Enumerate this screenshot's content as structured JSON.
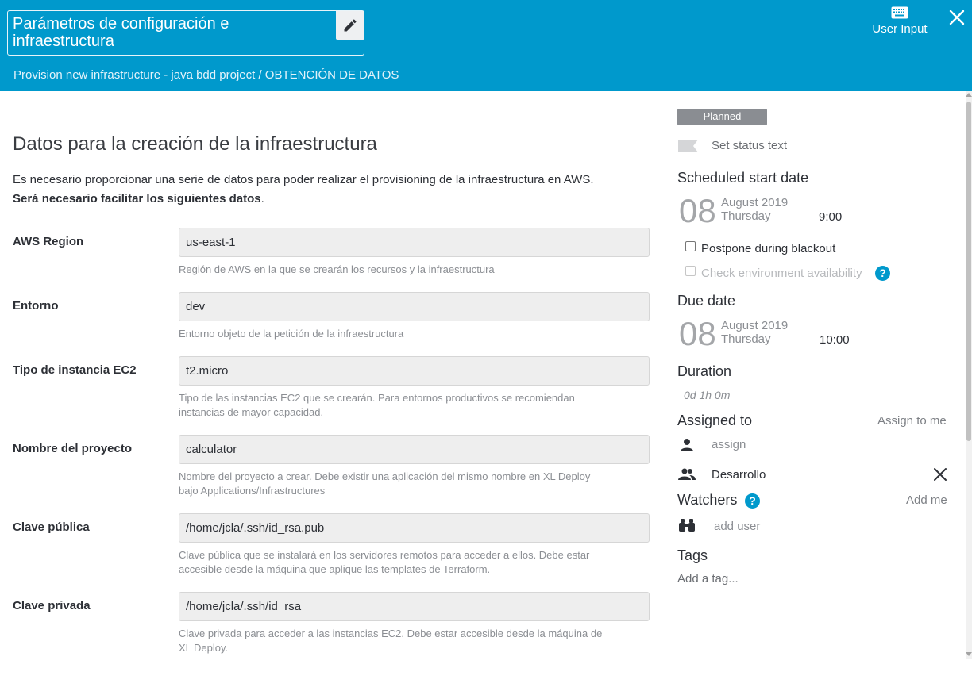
{
  "header": {
    "title": "Parámetros de configuración e infraestructura",
    "breadcrumb": "Provision new infrastructure - java bdd project / OBTENCIÓN DE DATOS",
    "user_input_label": "User Input",
    "edit_icon": "pencil-icon",
    "close_icon": "close-icon",
    "user_input_icon": "keyboard-icon",
    "bg_color": "#0099cc"
  },
  "main": {
    "heading": "Datos para la creación de la infraestructura",
    "intro_line1": "Es necesario proporcionar una serie de datos para poder realizar el provisioning de la infraestructura en AWS.",
    "intro_line2_bold": "Será necesario facilitar los siguientes datos",
    "intro_line2_end": ".",
    "fields": [
      {
        "label": "AWS Region",
        "value": "us-east-1",
        "help": "Región de AWS en la que se crearán los recursos y la infraestructura"
      },
      {
        "label": "Entorno",
        "value": "dev",
        "help": "Entorno objeto de la petición de la infraestructura"
      },
      {
        "label": "Tipo de instancia EC2",
        "value": "t2.micro",
        "help_line1": "Tipo de las instancias EC2 que se crearán. Para entornos productivos se recomiendan",
        "help_line2": "instancias de mayor capacidad."
      },
      {
        "label": "Nombre del proyecto",
        "value": "calculator",
        "help_line1": "Nombre del proyecto a crear. Debe existir una aplicación del mismo nombre en XL Deploy",
        "help_line2": "bajo Applications/Infrastructures"
      },
      {
        "label": "Clave pública",
        "value": "/home/jcla/.ssh/id_rsa.pub",
        "help_line1": "Clave pública que se instalará en los servidores remotos para acceder a ellos. Debe estar",
        "help_line2": "accesible desde la máquina que aplique las templates de Terraform."
      },
      {
        "label": "Clave privada",
        "value": "/home/jcla/.ssh/id_rsa",
        "help_line1": "Clave privada para acceder a las instancias EC2. Debe estar accesible desde la máquina de",
        "help_line2": "XL Deploy."
      }
    ]
  },
  "sidebar": {
    "status_badge": "Planned",
    "set_status_text": "Set status text",
    "scheduled_start": {
      "heading": "Scheduled start date",
      "day": "08",
      "month_year": "August 2019",
      "weekday": "Thursday",
      "time": "9:00"
    },
    "postpone_label": "Postpone during blackout",
    "check_env_label": "Check environment availability",
    "due": {
      "heading": "Due date",
      "day": "08",
      "month_year": "August 2019",
      "weekday": "Thursday",
      "time": "10:00"
    },
    "duration_heading": "Duration",
    "duration_value": "0d 1h 0m",
    "assigned_heading": "Assigned to",
    "assign_to_me": "Assign to me",
    "assign_placeholder": "assign",
    "team": "Desarrollo",
    "watchers_heading": "Watchers",
    "add_me": "Add me",
    "add_user": "add user",
    "tags_heading": "Tags",
    "add_tag": "Add a tag..."
  }
}
